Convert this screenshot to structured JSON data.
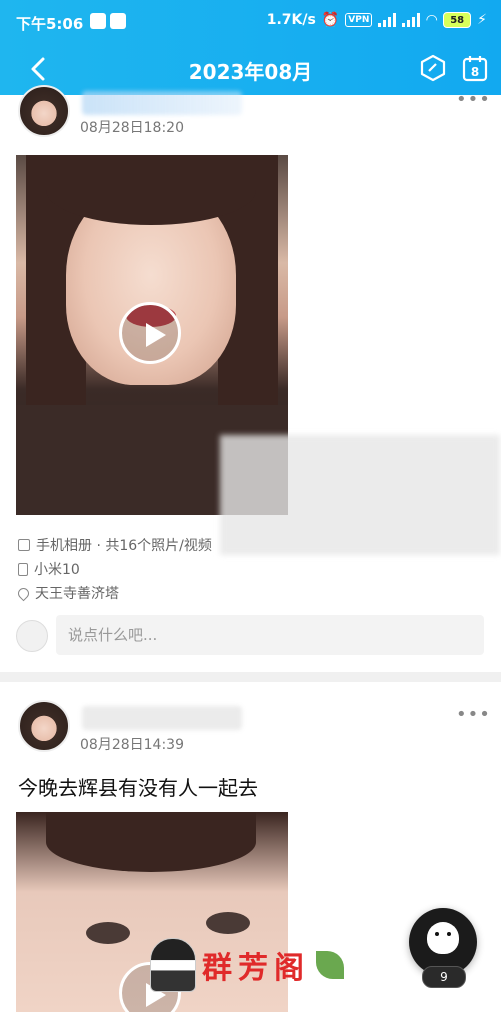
{
  "status_bar": {
    "time": "下午5:06",
    "network_speed": "1.7K/s",
    "vpn": "VPN",
    "battery": "58"
  },
  "nav": {
    "title": "2023年08月",
    "calendar_day": "8"
  },
  "posts": [
    {
      "time": "08月28日18:20",
      "album": "手机相册 · 共16个照片/视频",
      "device": "小米10",
      "location": "天王寺善济塔",
      "comment_placeholder": "说点什么吧..."
    },
    {
      "time": "08月28日14:39",
      "text": "今晚去辉县有没有人一起去"
    }
  ],
  "watermark": {
    "text": "群芳阁"
  },
  "float_button": {
    "badge": "9"
  },
  "colors": {
    "header_bg": "#1fb6ef",
    "watermark_text": "#e02a2a"
  }
}
